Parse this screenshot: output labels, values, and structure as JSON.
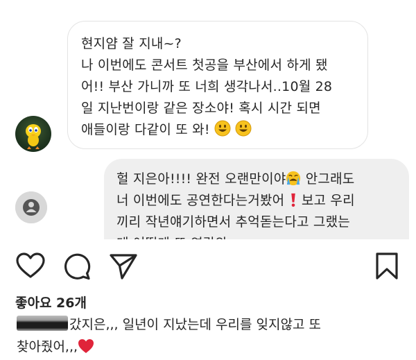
{
  "dm": {
    "incoming": {
      "lines": [
        "현지얌 잘 지내~?",
        "나 이번에도 콘서트 첫공을 부산에서 하게 됐",
        "어!! 부산 가니까 또 너희 생각나서..10월 28",
        "일 지난번이랑 같은 장소야! 혹시 시간 되면",
        "애들이랑 다같이 또 와!"
      ],
      "trailing_emoji": "grinning-face-emoji x2"
    },
    "outgoing": {
      "lines": [
        "헐 지은아!!!! 완전 오랜만이야",
        "안그래도",
        "너 이번에도 공연한다는거봤어",
        "보고 우리",
        "끼리 작년얘기하면서 추억돋는다고  그랬는",
        "데 어떻게 또 연락와 ..."
      ],
      "emojis": [
        "crying-face-emoji",
        "red-exclamation-emoji"
      ]
    }
  },
  "post": {
    "likes": "좋아요 26개",
    "caption": {
      "username_redacted": true,
      "text_line1": "갔지은,,, 일년이 지났는데 우리를 잊지않고 또",
      "text_line2": "찾아줬어,,,"
    }
  },
  "colors": {
    "bubble_border": "#e3e3e3",
    "outgoing_bubble": "#efefef",
    "heart_red": "#e0243a",
    "text": "#262626"
  }
}
